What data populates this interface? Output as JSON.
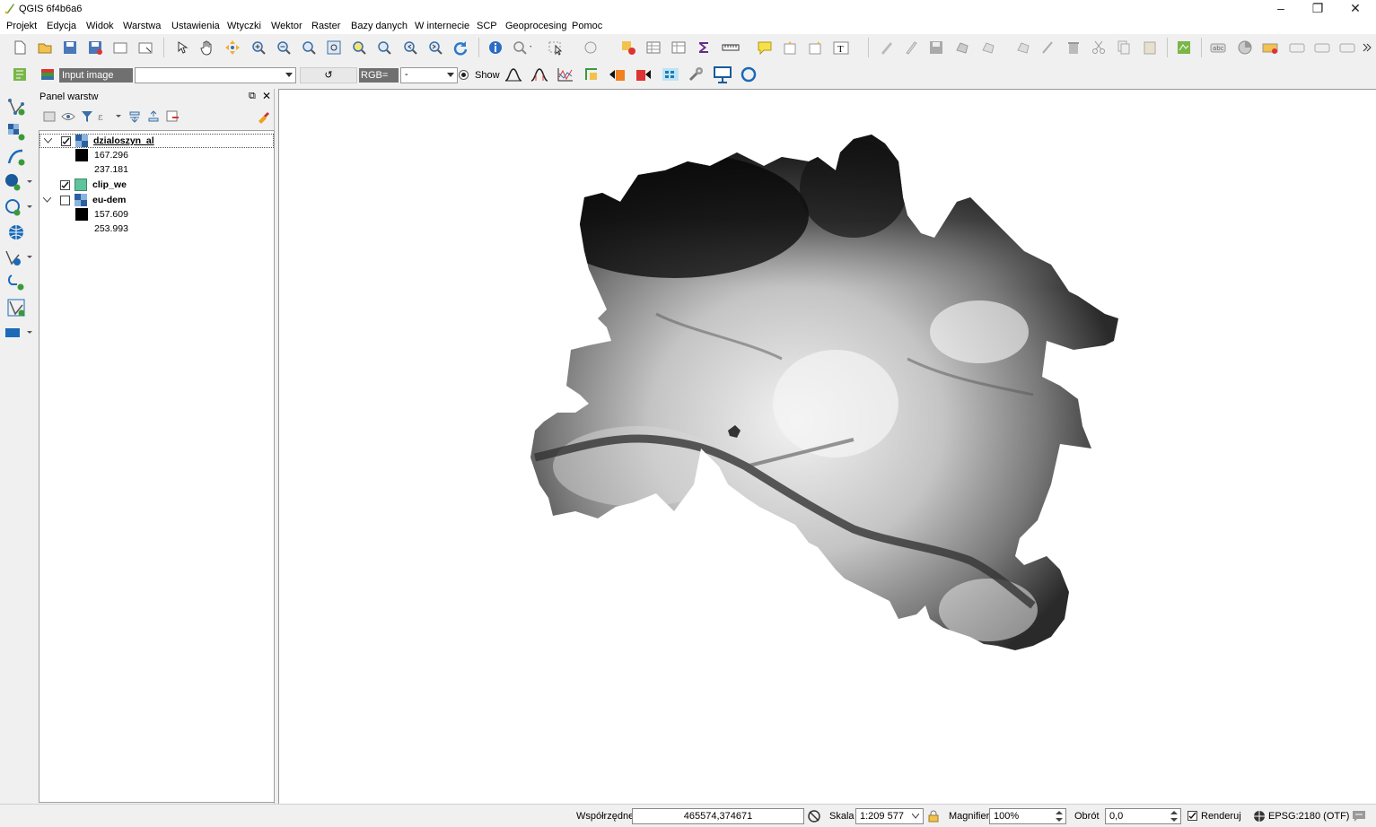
{
  "window": {
    "title": "QGIS 6f4b6a6",
    "minimize": "–",
    "restore": "❐",
    "close": "✕"
  },
  "menu": [
    "Projekt",
    "Edycja",
    "Widok",
    "Warstwa",
    "Ustawienia",
    "Wtyczki",
    "Wektor",
    "Raster",
    "Bazy danych",
    "W internecie",
    "SCP",
    "Geoprocesing",
    "Pomoc"
  ],
  "scp_toolbar": {
    "input_label": "Input image",
    "input_value": "",
    "refresh_icon": "↺",
    "rgb_label": "RGB=",
    "rgb_value": "-",
    "show_label": "Show"
  },
  "layers_panel": {
    "title": "Panel warstw",
    "layers": [
      {
        "name": "dzialoszyn_al",
        "checked": true,
        "expanded": true,
        "min": "167.296",
        "max": "237.181"
      },
      {
        "name": "clip_we",
        "checked": true,
        "swatch_color": "#5fc39c"
      },
      {
        "name": "eu-dem",
        "checked": false,
        "expanded": true,
        "min": "157.609",
        "max": "253.993"
      }
    ]
  },
  "status": {
    "coord_label": "Współrzędne",
    "coord_value": "465574,374671",
    "scale_label": "Skala",
    "scale_value": "1:209 577",
    "magnifier_label": "Magnifier",
    "magnifier_value": "100%",
    "rotation_label": "Obrót",
    "rotation_value": "0,0",
    "render_label": "Renderuj",
    "crs_label": "EPSG:2180 (OTF)"
  },
  "colors": {
    "accent": "#3a6ea5",
    "clip_swatch": "#5fc39c"
  }
}
